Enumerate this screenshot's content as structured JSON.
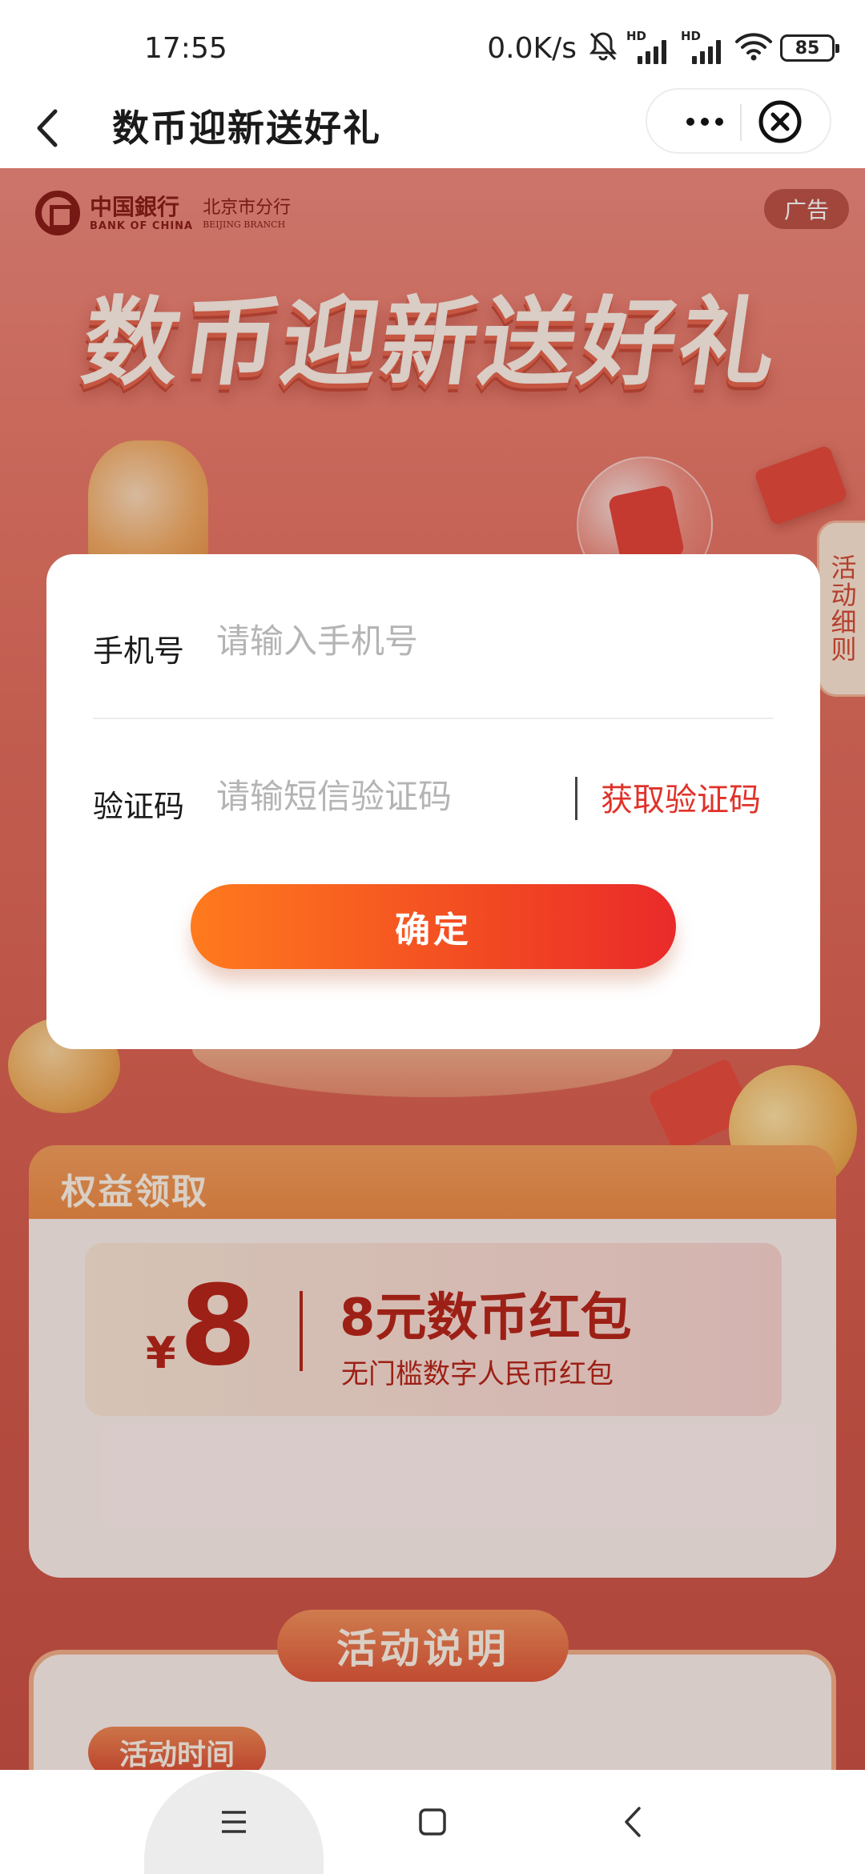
{
  "status_bar": {
    "time": "17:55",
    "network_speed": "0.0K/s",
    "signal_1_label": "HD",
    "signal_2_label": "HD",
    "battery_level": "85",
    "icons": [
      "mute-bell-icon",
      "signal-icon",
      "signal-icon",
      "wifi-icon",
      "battery-icon"
    ]
  },
  "title_bar": {
    "title": "数币迎新送好礼",
    "icons": [
      "back-arrow-icon",
      "more-dots-icon",
      "close-circle-icon"
    ]
  },
  "background_page": {
    "bank_name_cn": "中国銀行",
    "bank_name_en": "BANK OF CHINA",
    "branch_cn": "北京市分行",
    "branch_en": "BEIJING BRANCH",
    "ad_badge": "广告",
    "hero_title": "数币迎新送好礼",
    "side_rules": "活动细则",
    "benefit_section_title": "权益领取",
    "coupon": {
      "currency_symbol": "¥",
      "amount": "8",
      "name": "8元数币红包",
      "description": "无门槛数字人民币红包"
    },
    "rules_title": "活动说明",
    "rules_time_label": "活动时间",
    "colors": {
      "primary_red": "#b8251a",
      "accent_orange": "#ee8a44"
    }
  },
  "modal": {
    "phone_label": "手机号",
    "phone_placeholder": "请输入手机号",
    "phone_value": "",
    "code_label": "验证码",
    "code_placeholder": "请输短信验证码",
    "code_value": "",
    "get_code_label": "获取验证码",
    "confirm_label": "确定",
    "colors": {
      "button_start": "#ff7a1e",
      "button_end": "#ea2a2a",
      "link": "#e0322a"
    }
  },
  "nav_bar": {
    "icons": [
      "menu-icon",
      "home-square-icon",
      "back-chevron-icon"
    ]
  }
}
